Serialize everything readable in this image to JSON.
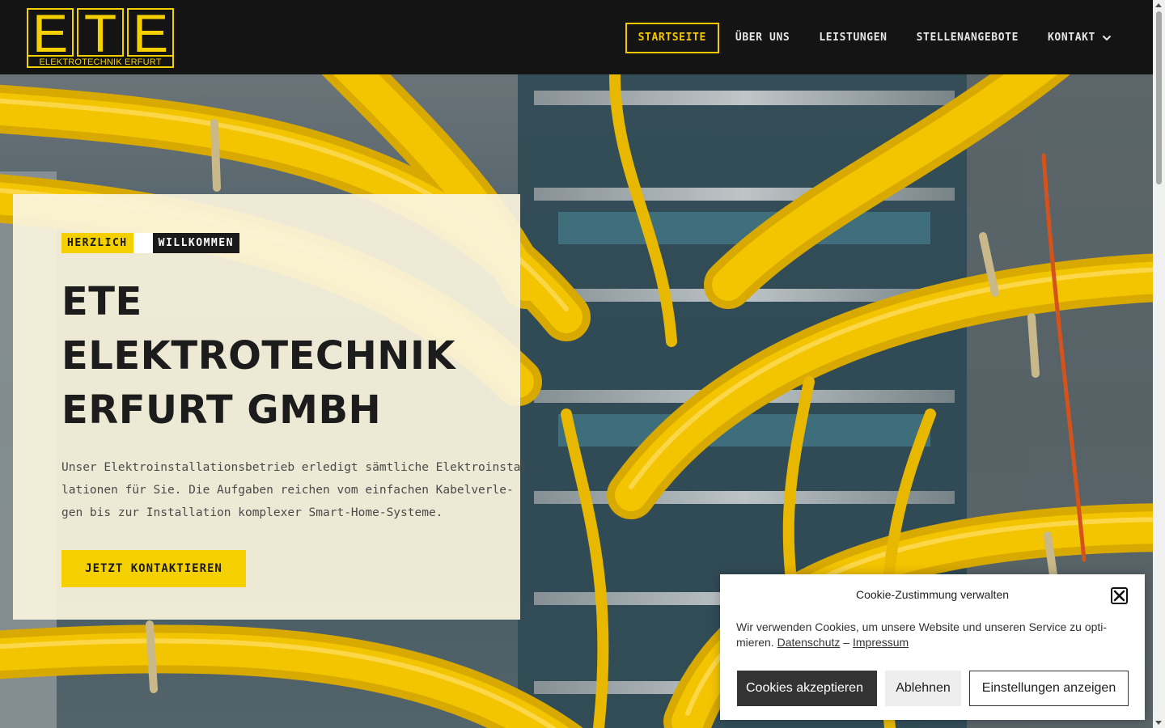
{
  "logo": {
    "letters": [
      "E",
      "T",
      "E"
    ],
    "subtitle": "ELEKTROTECHNIK ERFURT",
    "color": "#f5d000"
  },
  "nav": {
    "items": [
      {
        "label": "STARTSEITE",
        "active": true
      },
      {
        "label": "ÜBER UNS"
      },
      {
        "label": "LEISTUNGEN"
      },
      {
        "label": "STELLENANGEBOTE"
      },
      {
        "label": "KONTAKT",
        "has_dropdown": true
      }
    ],
    "accent": "#f5c800"
  },
  "hero": {
    "tag_primary": "HERZLICH",
    "tag_secondary": "WILLKOMMEN",
    "title_lines": [
      "ETE",
      "ELEKTROTECHNIK",
      "ERFURT GMBH"
    ],
    "text_lines": [
      "Unser Elektroinstallationsbetrieb erledigt sämtliche Elektroinstal-",
      "lationen für Sie. Die Aufgaben reichen vom einfachen Kabelverle-",
      "gen bis zur Installation komplexer Smart-Home-Systeme."
    ],
    "cta_label": "JETZT KONTAKTIEREN"
  },
  "cookie": {
    "title": "Cookie-Zustimmung verwalten",
    "text_line1": "Wir verwenden Cookies, um unsere Website und unseren Service zu opti-",
    "text_line2_prefix": "mieren.",
    "link_privacy": "Datenschutz",
    "separator": "–",
    "link_imprint": "Impressum",
    "accept_label": "Cookies akzeptieren",
    "deny_label": "Ablehnen",
    "settings_label": "Einstellungen anzeigen"
  }
}
